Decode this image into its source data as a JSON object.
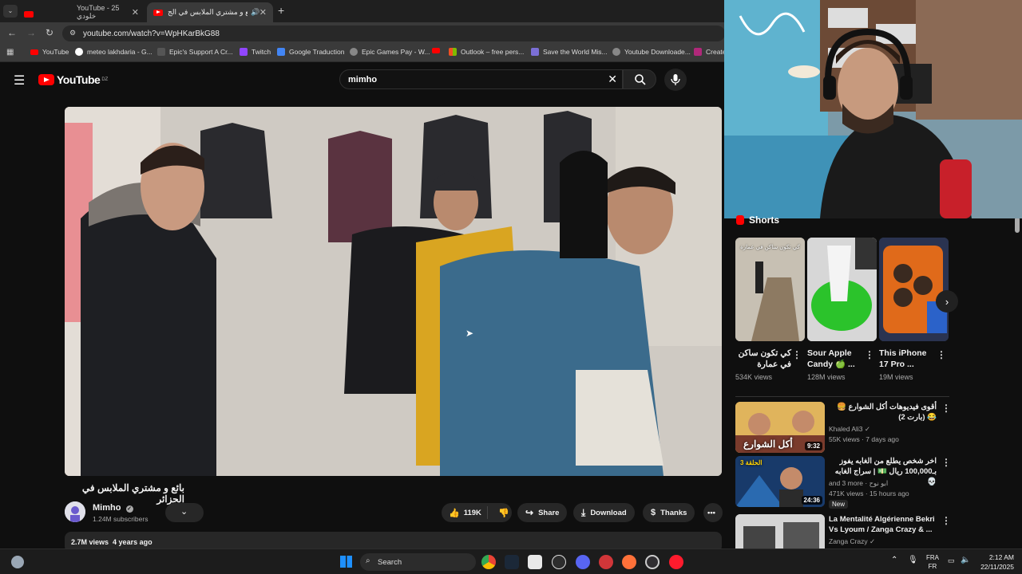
{
  "browser": {
    "tabs": [
      {
        "label": "YouTube - 25 خلودي",
        "active": false
      },
      {
        "label": "بائع و مشتري الملابس في الج",
        "active": true
      }
    ],
    "new_tab": "+",
    "url": "youtube.com/watch?v=WpHKarBkG88",
    "bookmarks": [
      "YouTube",
      "meteo lakhdaria - G...",
      "Epic's Support A Cr...",
      "Twitch",
      "Google Traduction",
      "Epic Games Pay - W...",
      "Outlook – free pers...",
      "Save the World Mis...",
      "Youtube Downloade...",
      "Create"
    ]
  },
  "youtube": {
    "logo": "YouTube",
    "region": "DZ",
    "search_value": "mimho",
    "video": {
      "title": "بائع و مشتري الملابس في الجزائر",
      "channel": "Mimho",
      "subscribers": "1.24M subscribers",
      "likes": "119K",
      "share": "Share",
      "download": "Download",
      "thanks": "Thanks",
      "views": "2.7M views",
      "age": "4 years ago"
    },
    "shorts": {
      "heading": "Shorts",
      "items": [
        {
          "title": "كي تكون ساكن في عمارة",
          "views": "534K views",
          "thumb_text": "كي تكون ساكن في عمارة"
        },
        {
          "title": "Sour Apple Candy 🍏 ...",
          "views": "128M views"
        },
        {
          "title": "This iPhone 17 Pro ...",
          "views": "19M views"
        }
      ]
    },
    "related": [
      {
        "title": "أقوى فيديوهات أكل الشوارع 🍔😂 (بارت 2)",
        "channel": "Khaled Ali3",
        "meta": "55K views · 7 days ago",
        "duration": "9:32",
        "thumb_text": "أكل الشوارع"
      },
      {
        "title": "اخر شخص يطلع من الغابه يفوز بـ100,000 ريال 💵 | سراج الغابه 💀",
        "channel": "and 3 more · ابو نوح",
        "meta": "471K views · 15 hours ago",
        "badge": "New",
        "duration": "24:36",
        "thumb_text": "الحلقة 3"
      },
      {
        "title": "La Mentalité Algérienne Bekri Vs Lyoum / Zanga Crazy & ...",
        "channel": "Zanga Crazy",
        "meta": "",
        "duration": ""
      }
    ]
  },
  "taskbar": {
    "search_label": "Search",
    "lang_top": "FRA",
    "lang_bottom": "FR",
    "time": "2:12 AM",
    "date": "22/11/2025"
  },
  "colors": {
    "accent": "#ff0000",
    "background": "#0f0f0f",
    "pill": "#272727"
  }
}
